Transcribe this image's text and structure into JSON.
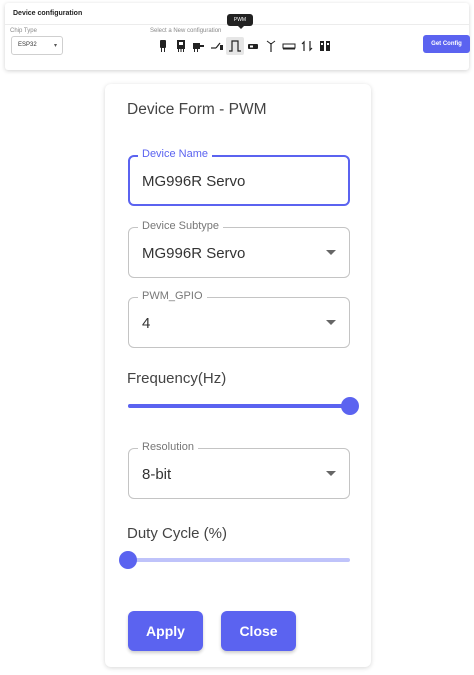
{
  "config_bar": {
    "title": "Device configuration",
    "chip_type_label": "Chip Type",
    "chip_type_value": "ESP32",
    "new_config_label": "Select a New configuration",
    "tooltip": "PWM",
    "get_config_label": "Get Config",
    "icons": [
      {
        "name": "sensor-icon",
        "glyph": "▄"
      },
      {
        "name": "module-icon",
        "glyph": "█"
      },
      {
        "name": "motor-icon",
        "glyph": "⚙"
      },
      {
        "name": "switch-icon",
        "glyph": "⇌"
      },
      {
        "name": "pwm-icon",
        "glyph": "⎍",
        "active": true
      },
      {
        "name": "servo-icon",
        "glyph": "▬"
      },
      {
        "name": "antenna-icon",
        "glyph": "Ψ"
      },
      {
        "name": "display-icon",
        "glyph": "═"
      },
      {
        "name": "swap-icon",
        "glyph": "⇅"
      },
      {
        "name": "battery-icon",
        "glyph": "▐"
      }
    ]
  },
  "form": {
    "title": "Device Form - PWM",
    "device_name_label": "Device Name",
    "device_name_value": "MG996R Servo",
    "device_subtype_label": "Device Subtype",
    "device_subtype_value": "MG996R Servo",
    "pwm_gpio_label": "PWM_GPIO",
    "pwm_gpio_value": "4",
    "frequency_label": "Frequency(Hz)",
    "frequency_fraction": 1.0,
    "resolution_label": "Resolution",
    "resolution_value": "8-bit",
    "duty_cycle_label": "Duty Cycle (%)",
    "duty_cycle_fraction": 0.0,
    "apply_label": "Apply",
    "close_label": "Close"
  },
  "colors": {
    "accent": "#5b63f0",
    "accent_light": "#bfc3fa"
  }
}
